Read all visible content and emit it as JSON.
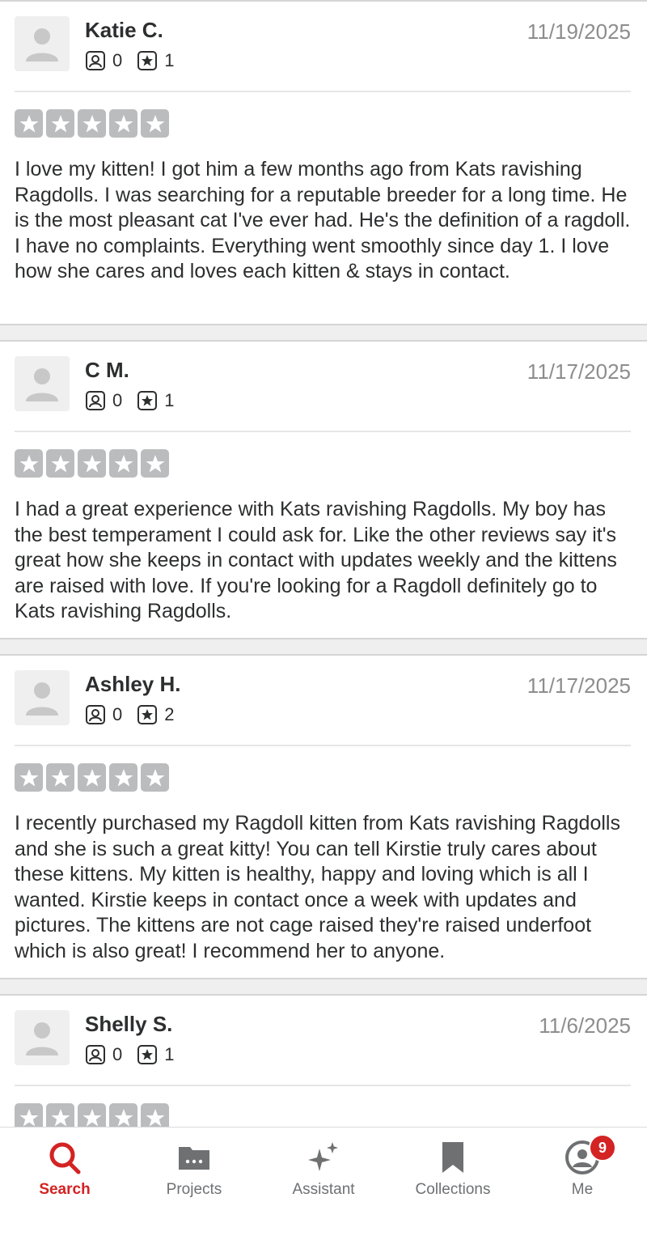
{
  "reviews": [
    {
      "name": "Katie C.",
      "date": "11/19/2025",
      "friends": "0",
      "reviews_count": "1",
      "rating": 5,
      "text": "I love my kitten! I got him a few months ago from Kats ravishing Ragdolls. I was searching for a reputable breeder for a long time. He is the most pleasant cat I've ever had. He's the definition of a ragdoll. I have no complaints. Everything went smoothly since day 1. I love how she cares and loves each kitten & stays in contact."
    },
    {
      "name": "C M.",
      "date": "11/17/2025",
      "friends": "0",
      "reviews_count": "1",
      "rating": 5,
      "text": "I had a great experience with Kats ravishing Ragdolls. My boy has the best temperament I could ask for. Like the other reviews say it's great how she keeps in contact with updates weekly and the kittens are raised with love. If you're looking for a Ragdoll definitely go to Kats ravishing Ragdolls."
    },
    {
      "name": "Ashley H.",
      "date": "11/17/2025",
      "friends": "0",
      "reviews_count": "2",
      "rating": 5,
      "text": "I recently purchased my Ragdoll kitten from Kats ravishing Ragdolls and she is such a great kitty! You can tell Kirstie truly cares about these kittens. My kitten is healthy, happy and loving which is all I wanted. Kirstie keeps in contact once a week with updates and pictures. The kittens are not cage raised they're raised underfoot which is also great! I recommend her to anyone."
    },
    {
      "name": "Shelly S.",
      "date": "11/6/2025",
      "friends": "0",
      "reviews_count": "1",
      "rating": 5,
      "text": ""
    }
  ],
  "tabbar": {
    "search": "Search",
    "projects": "Projects",
    "assistant": "Assistant",
    "collections": "Collections",
    "me": "Me",
    "me_badge": "9"
  },
  "icons": {
    "friends": "friends-icon",
    "reviews": "review-star-icon",
    "search": "search-icon",
    "projects": "projects-icon",
    "assistant": "sparkle-icon",
    "collections": "bookmark-icon",
    "me": "profile-icon"
  },
  "colors": {
    "accent": "#d32323",
    "star_empty": "#bbbcbd",
    "date": "#8d8d8d"
  }
}
